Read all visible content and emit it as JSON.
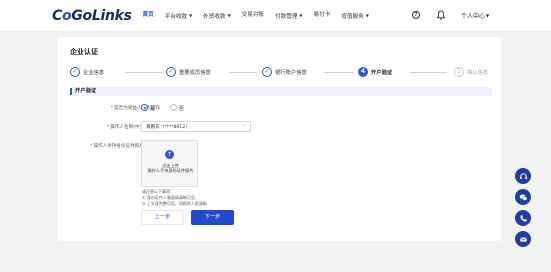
{
  "nav": {
    "logo_part1": "C",
    "logo_part2": "o",
    "logo_part3": "GoLinks",
    "items": [
      {
        "label": "首页"
      },
      {
        "label": "平台收款"
      },
      {
        "label": "外贸收款"
      },
      {
        "label": "交易对账"
      },
      {
        "label": "付款管理"
      },
      {
        "label": "易付卡"
      },
      {
        "label": "增值服务"
      }
    ],
    "help_icon": "?",
    "user_menu": "个人中心"
  },
  "page": {
    "title": "企业认证",
    "steps": [
      {
        "label": "企业信息",
        "state": "done",
        "icon": "check"
      },
      {
        "label": "重要成员信息",
        "state": "done",
        "icon": "check"
      },
      {
        "label": "银行账户信息",
        "state": "done",
        "icon": "check"
      },
      {
        "label": "开户验证",
        "state": "current",
        "number": "4"
      },
      {
        "label": "确认信息",
        "state": "todo",
        "number": "5"
      }
    ],
    "section_title": "开户验证"
  },
  "form": {
    "self_operated": {
      "label": "是否为受益人本人操作",
      "options": [
        {
          "label": "是",
          "checked": true
        },
        {
          "label": "否",
          "checked": false
        }
      ]
    },
    "operator_name": {
      "label": "操作人名称(中文)",
      "value": "黄鹏东（****8012）"
    },
    "id_photo": {
      "label": "操作人手持身份证件照片",
      "upload_line1": "点击上传",
      "upload_line2": "操作人手持身份证件照片"
    },
    "notes": {
      "title": "请注意以下事项：",
      "items": [
        "① 身份证件人像面请清晰可见",
        "② 上半身完整可见，同框的人脸清晰"
      ]
    }
  },
  "buttons": {
    "prev": "上一步",
    "next": "下一步"
  },
  "floating": [
    "headset-icon",
    "wechat-icon",
    "phone-icon",
    "mail-icon"
  ],
  "colors": {
    "primary": "#2e55d8",
    "primary_dark": "#2348c9",
    "fab": "#1f3f9f",
    "background": "#f2f3f5"
  }
}
